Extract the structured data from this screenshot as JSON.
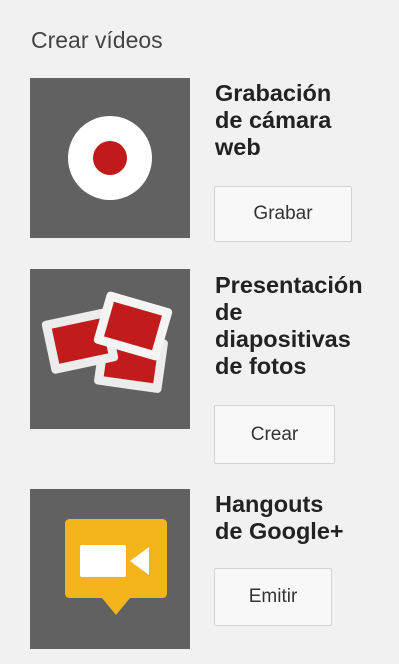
{
  "section": {
    "heading": "Crear vídeos"
  },
  "items": [
    {
      "title": "Grabación\nde cámara\nweb",
      "button_label": "Grabar",
      "icon": "record-icon"
    },
    {
      "title": "Presentación\nde\ndiapositivas\nde fotos",
      "button_label": "Crear",
      "icon": "slides-icon"
    },
    {
      "title": "Hangouts\nde Google+",
      "button_label": "Emitir",
      "icon": "hangouts-video-icon"
    }
  ],
  "colors": {
    "thumb_background": "#616161",
    "record_red": "#c01a1a",
    "slide_red": "#c11b1b",
    "hangouts_yellow": "#f3b51b"
  }
}
